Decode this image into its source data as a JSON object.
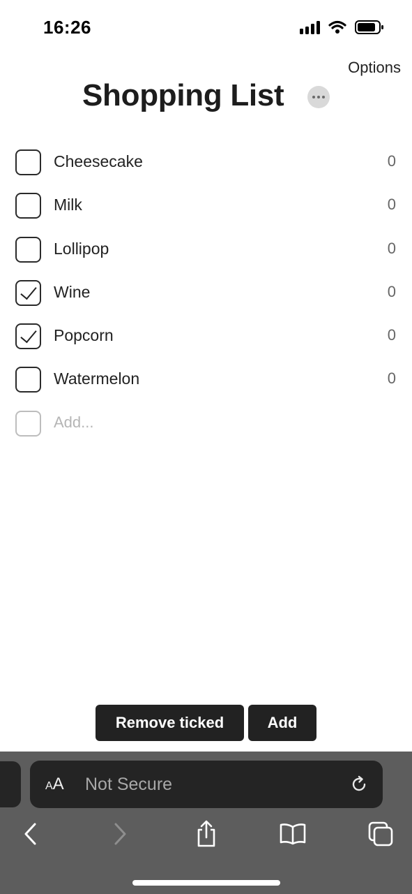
{
  "status_bar": {
    "time": "16:26"
  },
  "header": {
    "options_label": "Options",
    "title": "Shopping List"
  },
  "list": {
    "items": [
      {
        "label": "Cheesecake",
        "qty": "0",
        "ticked": false
      },
      {
        "label": "Milk",
        "qty": "0",
        "ticked": false
      },
      {
        "label": "Lollipop",
        "qty": "0",
        "ticked": false
      },
      {
        "label": "Wine",
        "qty": "0",
        "ticked": true
      },
      {
        "label": "Popcorn",
        "qty": "0",
        "ticked": true
      },
      {
        "label": "Watermelon",
        "qty": "0",
        "ticked": false
      }
    ],
    "add_placeholder": "Add..."
  },
  "actions": {
    "remove_ticked_label": "Remove ticked",
    "add_label": "Add"
  },
  "browser": {
    "aa_large": "A",
    "aa_small": "A",
    "address_text": "Not Secure",
    "icons": [
      "reload-icon",
      "back-icon",
      "forward-icon",
      "share-icon",
      "bookmarks-icon",
      "tabs-icon"
    ]
  }
}
